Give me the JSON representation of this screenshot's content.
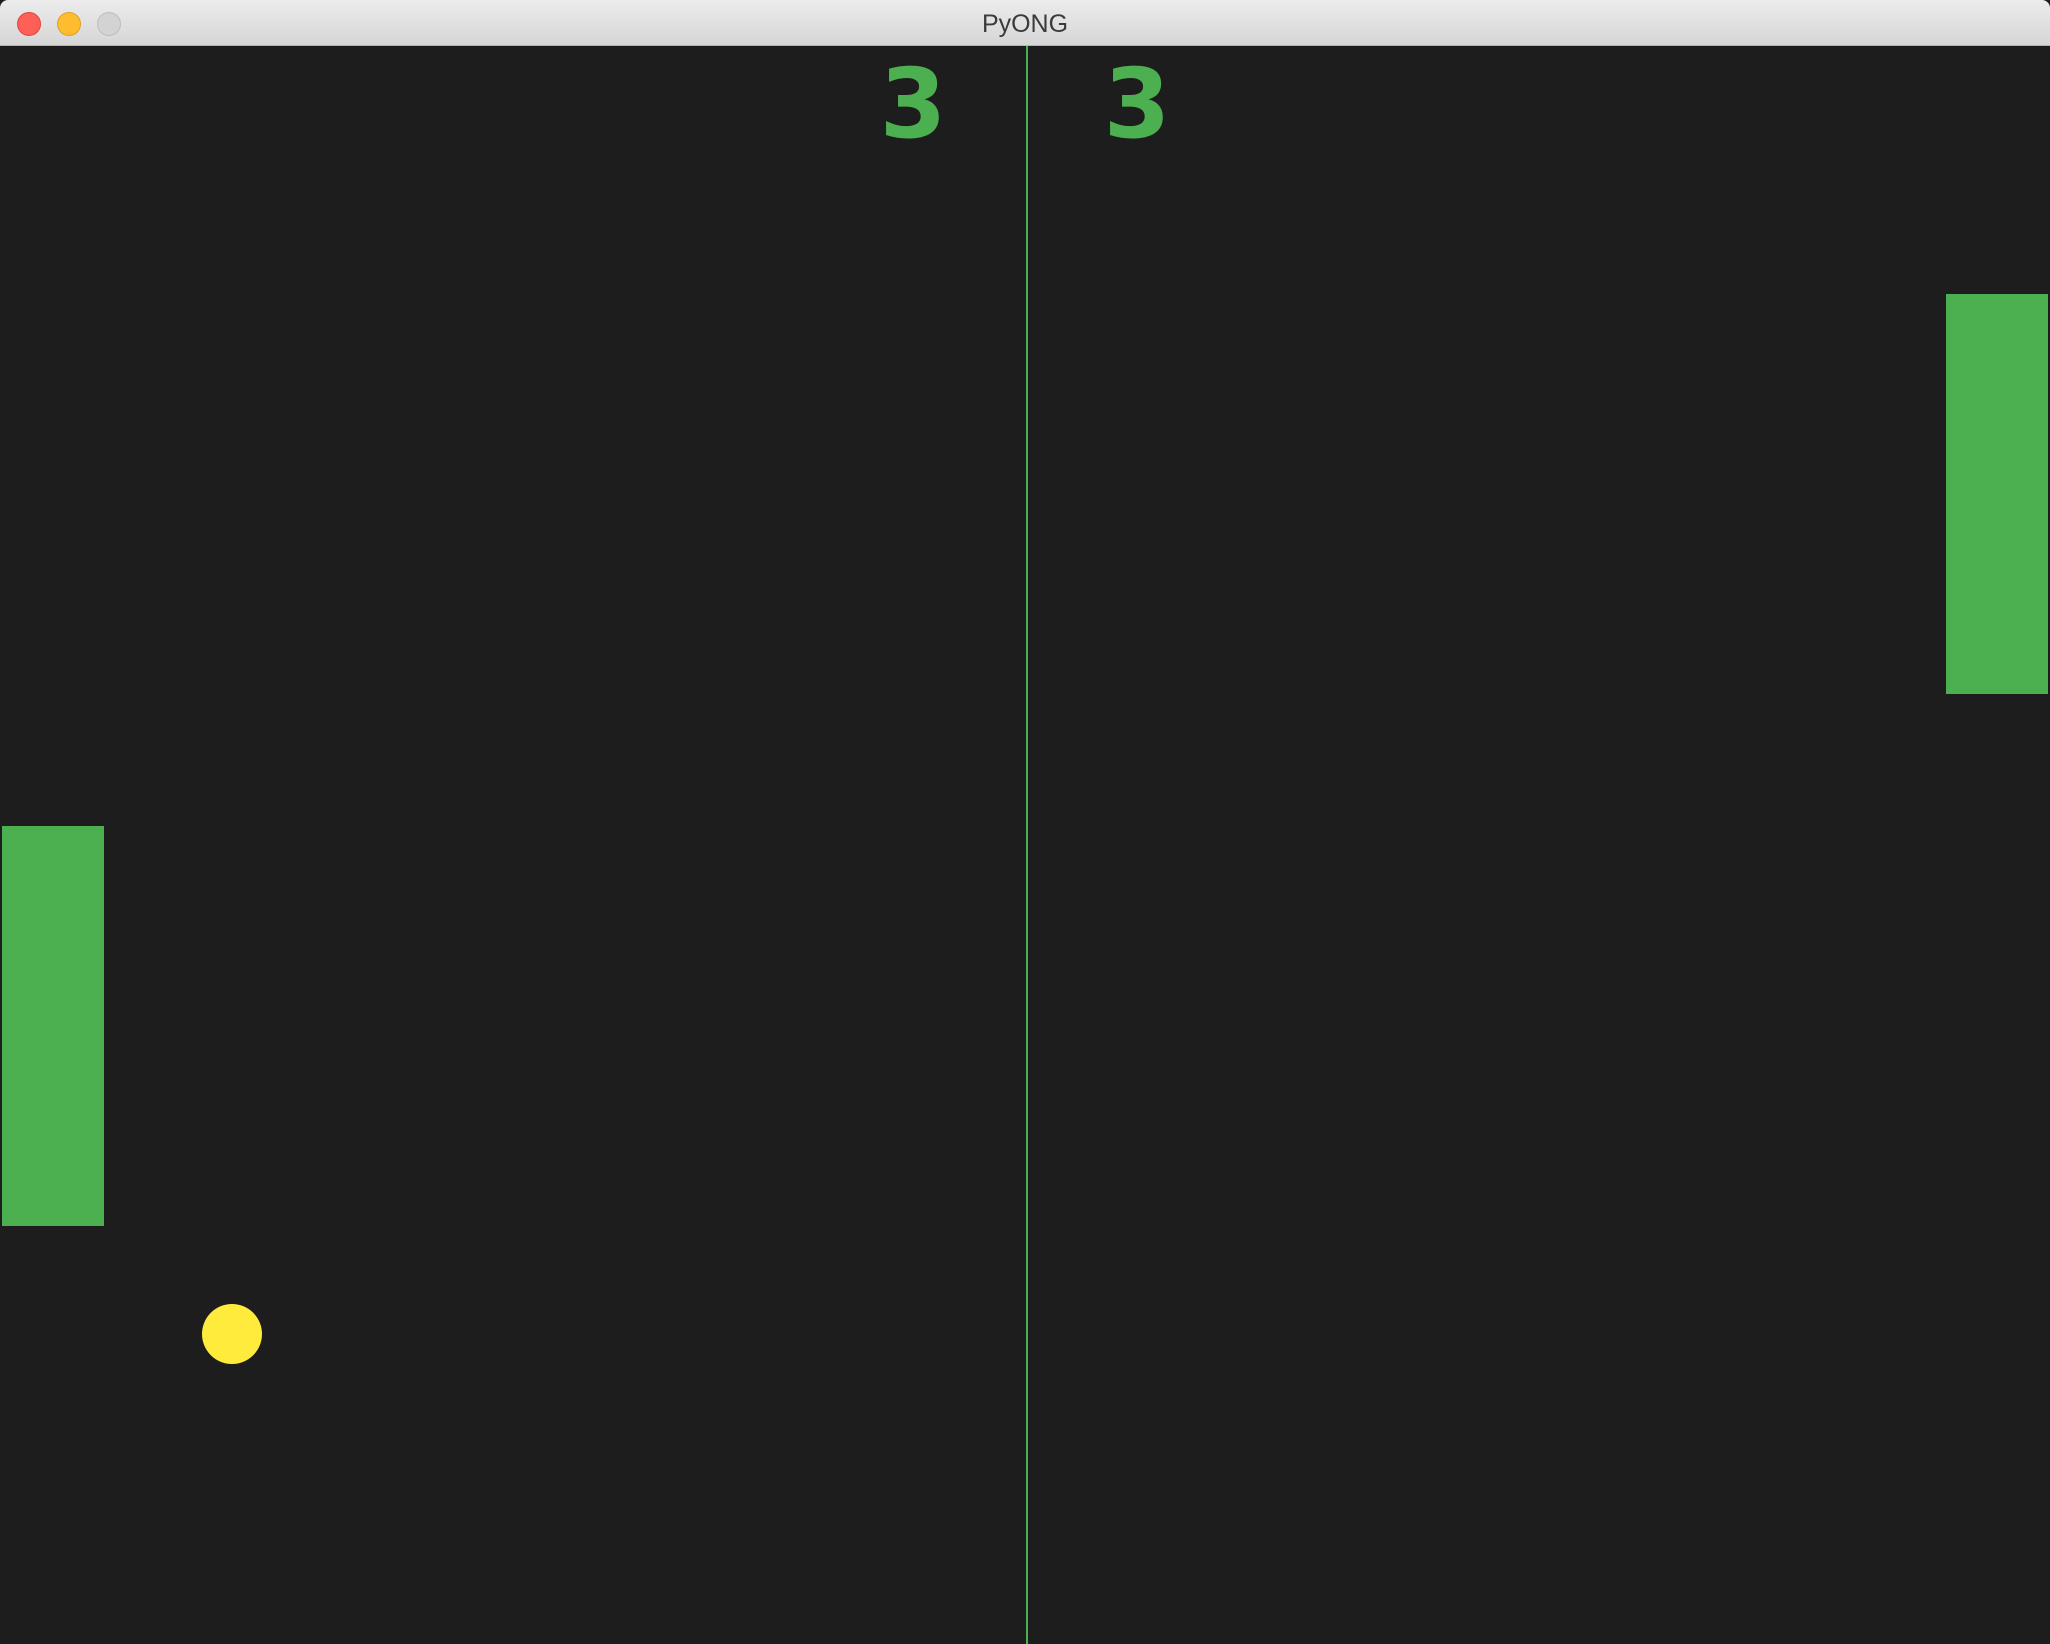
{
  "window": {
    "title": "PyONG"
  },
  "scoreboard": {
    "left_score": "3",
    "right_score": "3"
  },
  "colors": {
    "background": "#1d1d1d",
    "paddle": "#4caf50",
    "center_line": "#4caf50",
    "score": "#4caf50",
    "ball": "#ffeb3b"
  }
}
